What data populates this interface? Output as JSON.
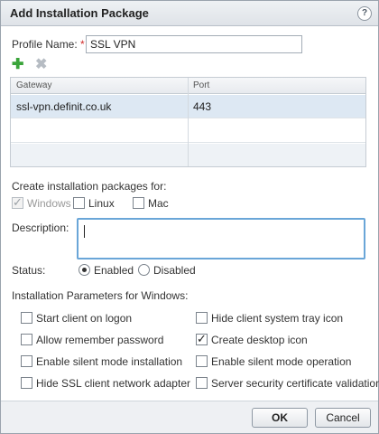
{
  "dialog": {
    "title": "Add Installation Package",
    "help_icon": "?"
  },
  "profile": {
    "label": "Profile Name:",
    "required_mark": "*",
    "value": "SSL VPN"
  },
  "toolbar": {
    "add_icon": "add-icon",
    "delete_icon": "delete-icon"
  },
  "gateways": {
    "columns": [
      "Gateway",
      "Port"
    ],
    "rows": [
      [
        "ssl-vpn.definit.co.uk",
        "443"
      ]
    ]
  },
  "platforms": {
    "label": "Create installation packages for:",
    "items": [
      {
        "label": "Windows",
        "checked": true,
        "disabled": true
      },
      {
        "label": "Linux",
        "checked": false,
        "disabled": false
      },
      {
        "label": "Mac",
        "checked": false,
        "disabled": false
      }
    ]
  },
  "description": {
    "label": "Description:",
    "value": ""
  },
  "status": {
    "label": "Status:",
    "enabled_label": "Enabled",
    "disabled_label": "Disabled",
    "selected": "Enabled"
  },
  "params": {
    "label": "Installation Parameters for Windows:",
    "options": [
      {
        "label": "Start client on logon",
        "checked": false
      },
      {
        "label": "Hide client system tray icon",
        "checked": false
      },
      {
        "label": "Allow remember password",
        "checked": false
      },
      {
        "label": "Create desktop icon",
        "checked": true
      },
      {
        "label": "Enable silent mode installation",
        "checked": false
      },
      {
        "label": "Enable silent mode operation",
        "checked": false
      },
      {
        "label": "Hide SSL client network adapter",
        "checked": false
      },
      {
        "label": "Server security certificate validation",
        "checked": false
      }
    ]
  },
  "buttons": {
    "ok": "OK",
    "cancel": "Cancel"
  },
  "colors": {
    "accent": "#6aa6d8",
    "selected_row": "#dde8f3",
    "add_icon": "#3aa43a"
  }
}
